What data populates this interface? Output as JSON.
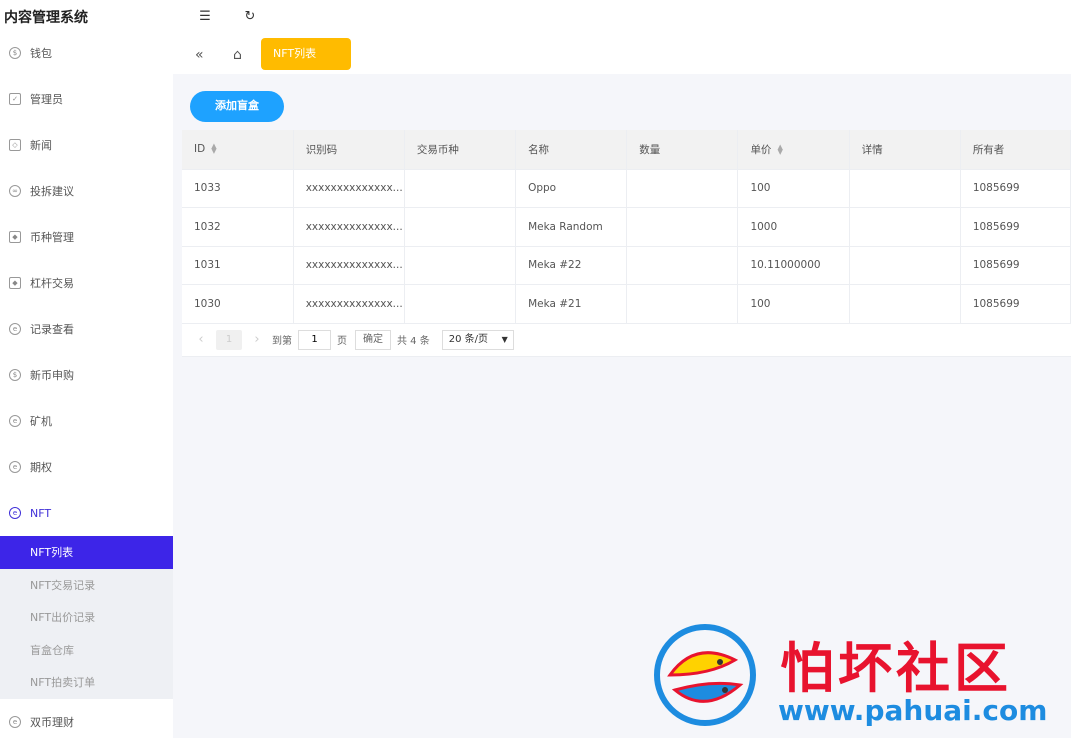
{
  "app": {
    "title": "内容管理系统"
  },
  "sidebar": {
    "items": [
      {
        "label": "钱包",
        "icon": "dollar-icon"
      },
      {
        "label": "管理员",
        "icon": "shield-icon"
      },
      {
        "label": "新闻",
        "icon": "tag-icon"
      },
      {
        "label": "投拆建议",
        "icon": "link-icon"
      },
      {
        "label": "币种管理",
        "icon": "diamond-icon"
      },
      {
        "label": "杠杆交易",
        "icon": "diamond-icon"
      },
      {
        "label": "记录查看",
        "icon": "circle-e-icon"
      },
      {
        "label": "新币申购",
        "icon": "dollar-icon"
      },
      {
        "label": "矿机",
        "icon": "circle-e-icon"
      },
      {
        "label": "期权",
        "icon": "circle-e-icon"
      },
      {
        "label": "NFT",
        "icon": "circle-e-icon"
      }
    ],
    "submenu": [
      {
        "label": "NFT列表"
      },
      {
        "label": "NFT交易记录"
      },
      {
        "label": "NFT出价记录"
      },
      {
        "label": "盲盒仓库"
      },
      {
        "label": "NFT拍卖订单"
      }
    ],
    "after": [
      {
        "label": "双币理财",
        "icon": "circle-e-icon"
      }
    ]
  },
  "tabs": {
    "active_label": "NFT列表"
  },
  "actions": {
    "add_label": "添加盲盒"
  },
  "table": {
    "headers": [
      "ID",
      "识别码",
      "交易币种",
      "名称",
      "数量",
      "单价",
      "详情",
      "所有者"
    ],
    "rows": [
      [
        "1033",
        "xxxxxxxxxxxxxx...",
        "",
        "Oppo",
        "",
        "100",
        "",
        "1085699"
      ],
      [
        "1032",
        "xxxxxxxxxxxxxx...",
        "",
        "Meka Random",
        "",
        "1000",
        "",
        "1085699"
      ],
      [
        "1031",
        "xxxxxxxxxxxxxx...",
        "",
        "Meka #22",
        "",
        "10.11000000",
        "",
        "1085699"
      ],
      [
        "1030",
        "xxxxxxxxxxxxxx...",
        "",
        "Meka #21",
        "",
        "100",
        "",
        "1085699"
      ]
    ]
  },
  "pager": {
    "current": "1",
    "goto_label": "到第",
    "page_value": "1",
    "page_unit": "页",
    "confirm_label": "确定",
    "total_label": "共 4 条",
    "size_label": "20 条/页"
  },
  "watermark": {
    "cn": "怕坏社区",
    "url": "www.pahuai.com"
  }
}
